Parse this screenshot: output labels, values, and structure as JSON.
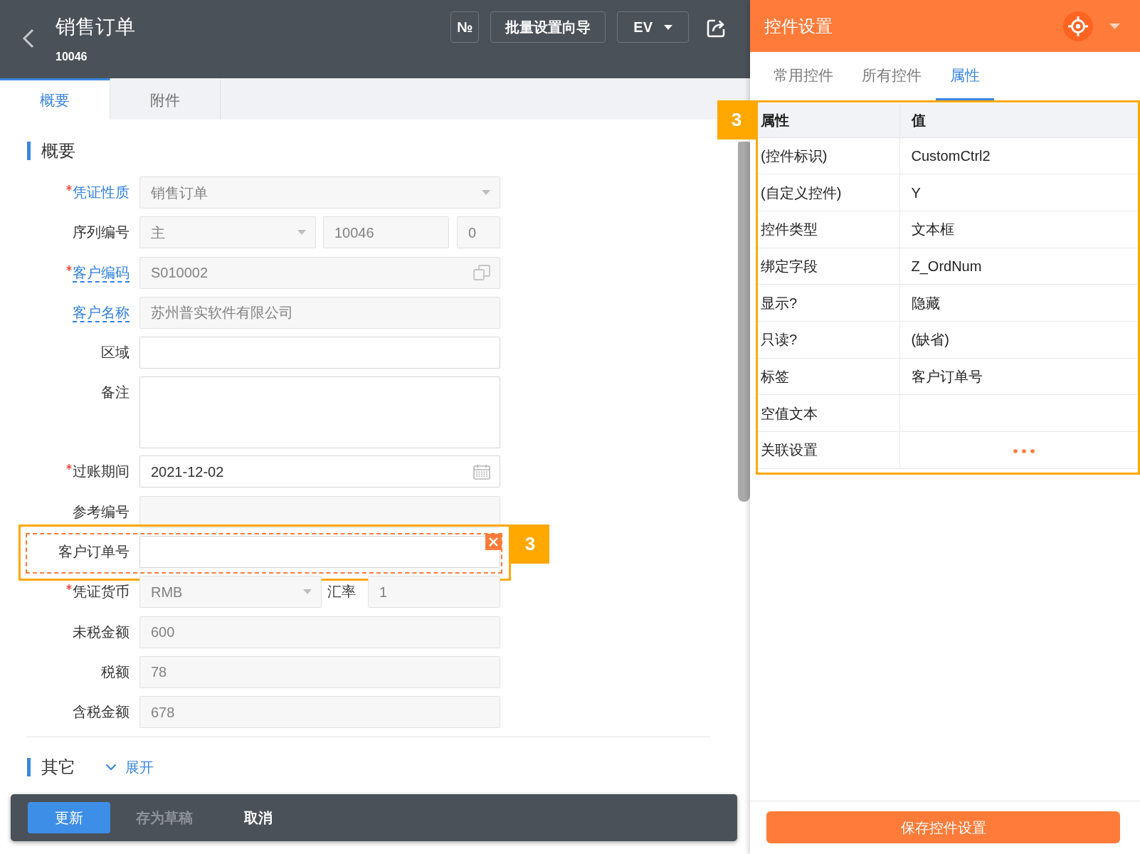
{
  "header": {
    "title": "销售订单",
    "subtitle": "10046",
    "buttons": [
      {
        "label": "№",
        "kind": "symbol"
      },
      {
        "label": "批量设置向导",
        "kind": "text"
      },
      {
        "label": "EV",
        "kind": "dropdown"
      }
    ]
  },
  "tabs": [
    {
      "label": "概要",
      "selected": true
    },
    {
      "label": "附件",
      "selected": false
    }
  ],
  "sections": [
    {
      "title": "概要",
      "fields": [
        {
          "label": "凭证性质",
          "required": true,
          "highlighted": true,
          "linked": false,
          "kind": "select",
          "value": "销售订单",
          "disabled": true,
          "selected": false
        },
        {
          "label": "序列编号",
          "required": false,
          "highlighted": false,
          "linked": false,
          "kind": "serial",
          "parts": [
            {
              "kind": "select",
              "value": "主"
            },
            {
              "kind": "text",
              "value": "10046"
            },
            {
              "kind": "text",
              "value": "0"
            }
          ],
          "disabled": true,
          "selected": false
        },
        {
          "label": "客户编码",
          "required": true,
          "highlighted": true,
          "linked": true,
          "kind": "lookup",
          "value": "S010002",
          "disabled": true,
          "selected": false
        },
        {
          "label": "客户名称",
          "required": false,
          "highlighted": true,
          "linked": true,
          "kind": "text",
          "value": "苏州普实软件有限公司",
          "disabled": true,
          "selected": false
        },
        {
          "label": "区域",
          "required": false,
          "highlighted": false,
          "linked": false,
          "kind": "text",
          "disabled": false,
          "selected": false
        },
        {
          "label": "备注",
          "required": false,
          "highlighted": false,
          "linked": false,
          "kind": "textarea",
          "disabled": false,
          "selected": false
        },
        {
          "label": "过账期间",
          "required": true,
          "highlighted": false,
          "linked": false,
          "kind": "date",
          "value": "2021-12-02",
          "disabled": false,
          "selected": false
        },
        {
          "label": "参考编号",
          "required": false,
          "highlighted": false,
          "linked": false,
          "kind": "text",
          "disabled": true,
          "selected": false
        },
        {
          "label": "客户订单号",
          "required": false,
          "highlighted": false,
          "linked": false,
          "kind": "text",
          "disabled": false,
          "selected": true,
          "annotation": "3"
        },
        {
          "label": "凭证货币",
          "required": true,
          "highlighted": false,
          "linked": false,
          "kind": "currency",
          "parts": [
            {
              "kind": "select",
              "value": "RMB"
            },
            {
              "kind": "label",
              "value": "汇率"
            },
            {
              "kind": "text",
              "value": "1"
            }
          ],
          "disabled": true,
          "selected": false
        },
        {
          "label": "未税金额",
          "required": false,
          "highlighted": false,
          "linked": false,
          "kind": "text",
          "value": "600",
          "disabled": true,
          "selected": false
        },
        {
          "label": "税额",
          "required": false,
          "highlighted": false,
          "linked": false,
          "kind": "text",
          "value": "78",
          "disabled": true,
          "selected": false
        },
        {
          "label": "含税金额",
          "required": false,
          "highlighted": false,
          "linked": false,
          "kind": "text",
          "value": "678",
          "disabled": true,
          "selected": false
        }
      ]
    },
    {
      "title": "其它",
      "toggle": "展开"
    }
  ],
  "actions": [
    {
      "label": "更新",
      "kind": "primary",
      "disabled": false
    },
    {
      "label": "存为草稿",
      "kind": "plain",
      "disabled": true
    },
    {
      "label": "取消",
      "kind": "plain",
      "disabled": false
    }
  ],
  "panel": {
    "title": "控件设置",
    "tabs": [
      {
        "label": "常用控件",
        "selected": false
      },
      {
        "label": "所有控件",
        "selected": false
      },
      {
        "label": "属性",
        "selected": true
      }
    ],
    "table": {
      "annotation": "3",
      "columns": [
        "属性",
        "值"
      ],
      "rows": [
        {
          "property": "(控件标识)",
          "kind": "text",
          "value": "CustomCtrl2"
        },
        {
          "property": "(自定义控件)",
          "kind": "text",
          "value": "Y"
        },
        {
          "property": "控件类型",
          "kind": "text",
          "value": "文本框"
        },
        {
          "property": "绑定字段",
          "kind": "text",
          "value": "Z_OrdNum"
        },
        {
          "property": "显示?",
          "kind": "text",
          "value": "隐藏"
        },
        {
          "property": "只读?",
          "kind": "text",
          "value": "(缺省)"
        },
        {
          "property": "标签",
          "kind": "text",
          "value": "客户订单号"
        },
        {
          "property": "空值文本",
          "kind": "text"
        },
        {
          "property": "关联设置",
          "kind": "ellipsis"
        }
      ]
    },
    "save_button": "保存控件设置"
  }
}
